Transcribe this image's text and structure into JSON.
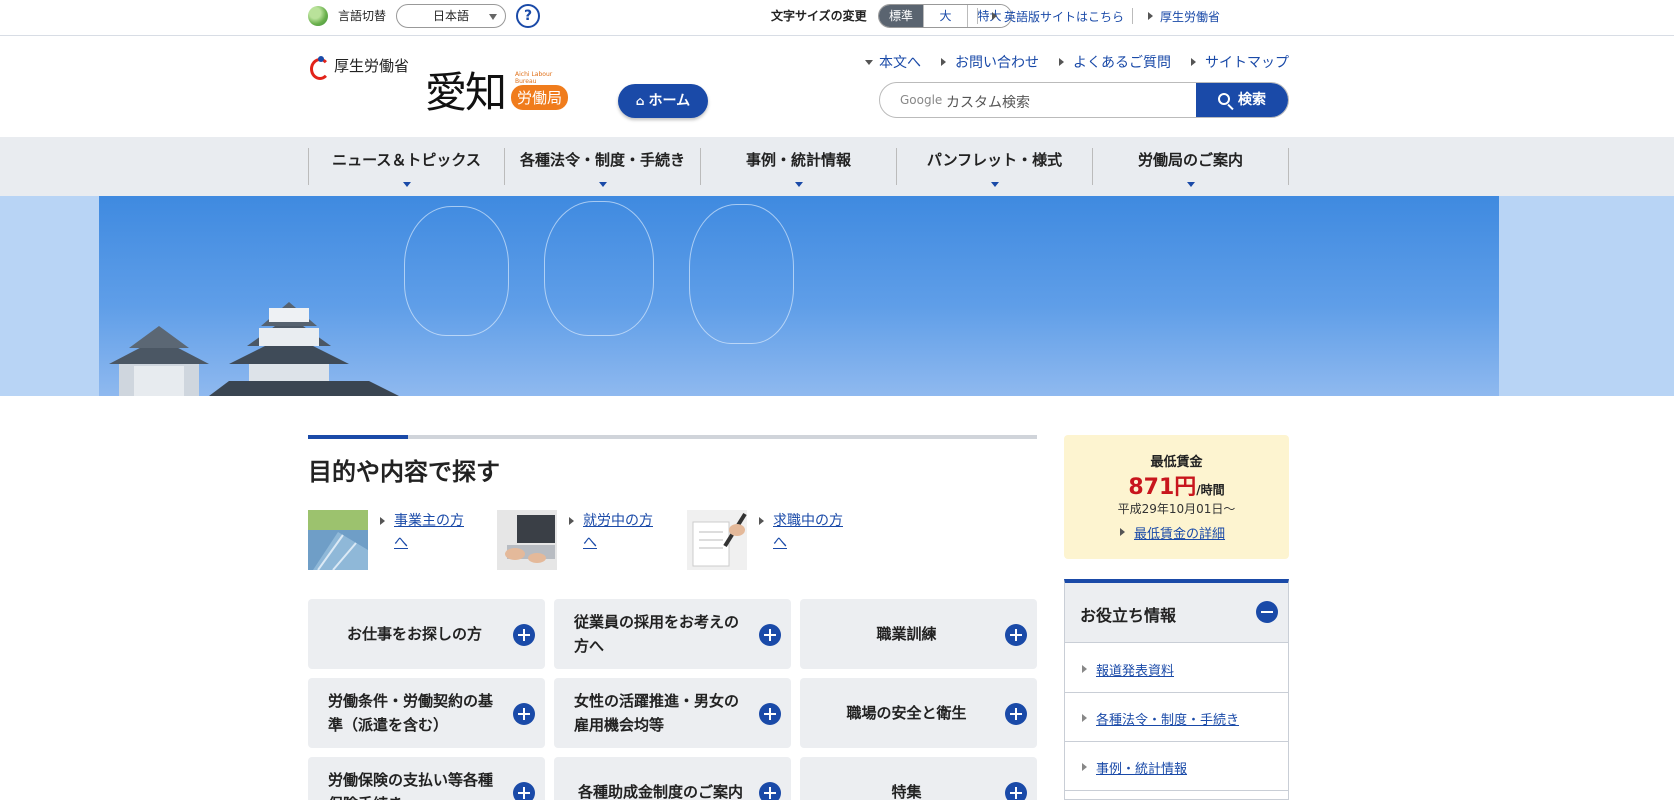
{
  "util": {
    "lang_label": "言語切替",
    "lang_selected": "日本語",
    "help": "?",
    "font_size_label": "文字サイズの変更",
    "font_sizes": [
      "標準",
      "大",
      "特大"
    ],
    "english_link": "英語版サイトはこちら",
    "mhlw_link": "厚生労働省"
  },
  "header": {
    "mhlw_name": "厚生労働省",
    "office_main": "愛知",
    "office_sub": "労働局",
    "office_en": "Aichi Labour Bureau",
    "home_label": "ホーム",
    "links": [
      "本文へ",
      "お問い合わせ",
      "よくあるご質問",
      "サイトマップ"
    ],
    "search_google": "Google",
    "search_placeholder": "カスタム検索",
    "search_button": "検索"
  },
  "gnav": [
    "ニュース＆トピックス",
    "各種法令・制度・手続き",
    "事例・統計情報",
    "パンフレット・様式",
    "労働局のご案内"
  ],
  "main": {
    "title": "目的や内容で探す",
    "personas": [
      "事業主の方へ",
      "就労中の方へ",
      "求職中の方へ"
    ],
    "cards": [
      "お仕事をお探しの方",
      "従業員の採用をお考えの方へ",
      "職業訓練",
      "労働条件・労働契約の基準（派遣を含む）",
      "女性の活躍推進・男女の雇用機会均等",
      "職場の安全と衛生",
      "労働保険の支払い等各種保険手続き",
      "各種助成金制度のご案内",
      "特集"
    ]
  },
  "sidebar": {
    "wage_title": "最低賃金",
    "wage_amount": "871円",
    "wage_unit": "/時間",
    "wage_date": "平成29年10月01日〜",
    "wage_link": "最低賃金の詳細",
    "useful_title": "お役立ち情報",
    "useful_items": [
      "報道発表資料",
      "各種法令・制度・手続き",
      "事例・統計情報"
    ]
  },
  "colors": {
    "brand_blue": "#1a4aa8",
    "wage_red": "#c8161d",
    "wage_bg": "#fdf4d0",
    "nav_bg": "#e9ecf0"
  }
}
